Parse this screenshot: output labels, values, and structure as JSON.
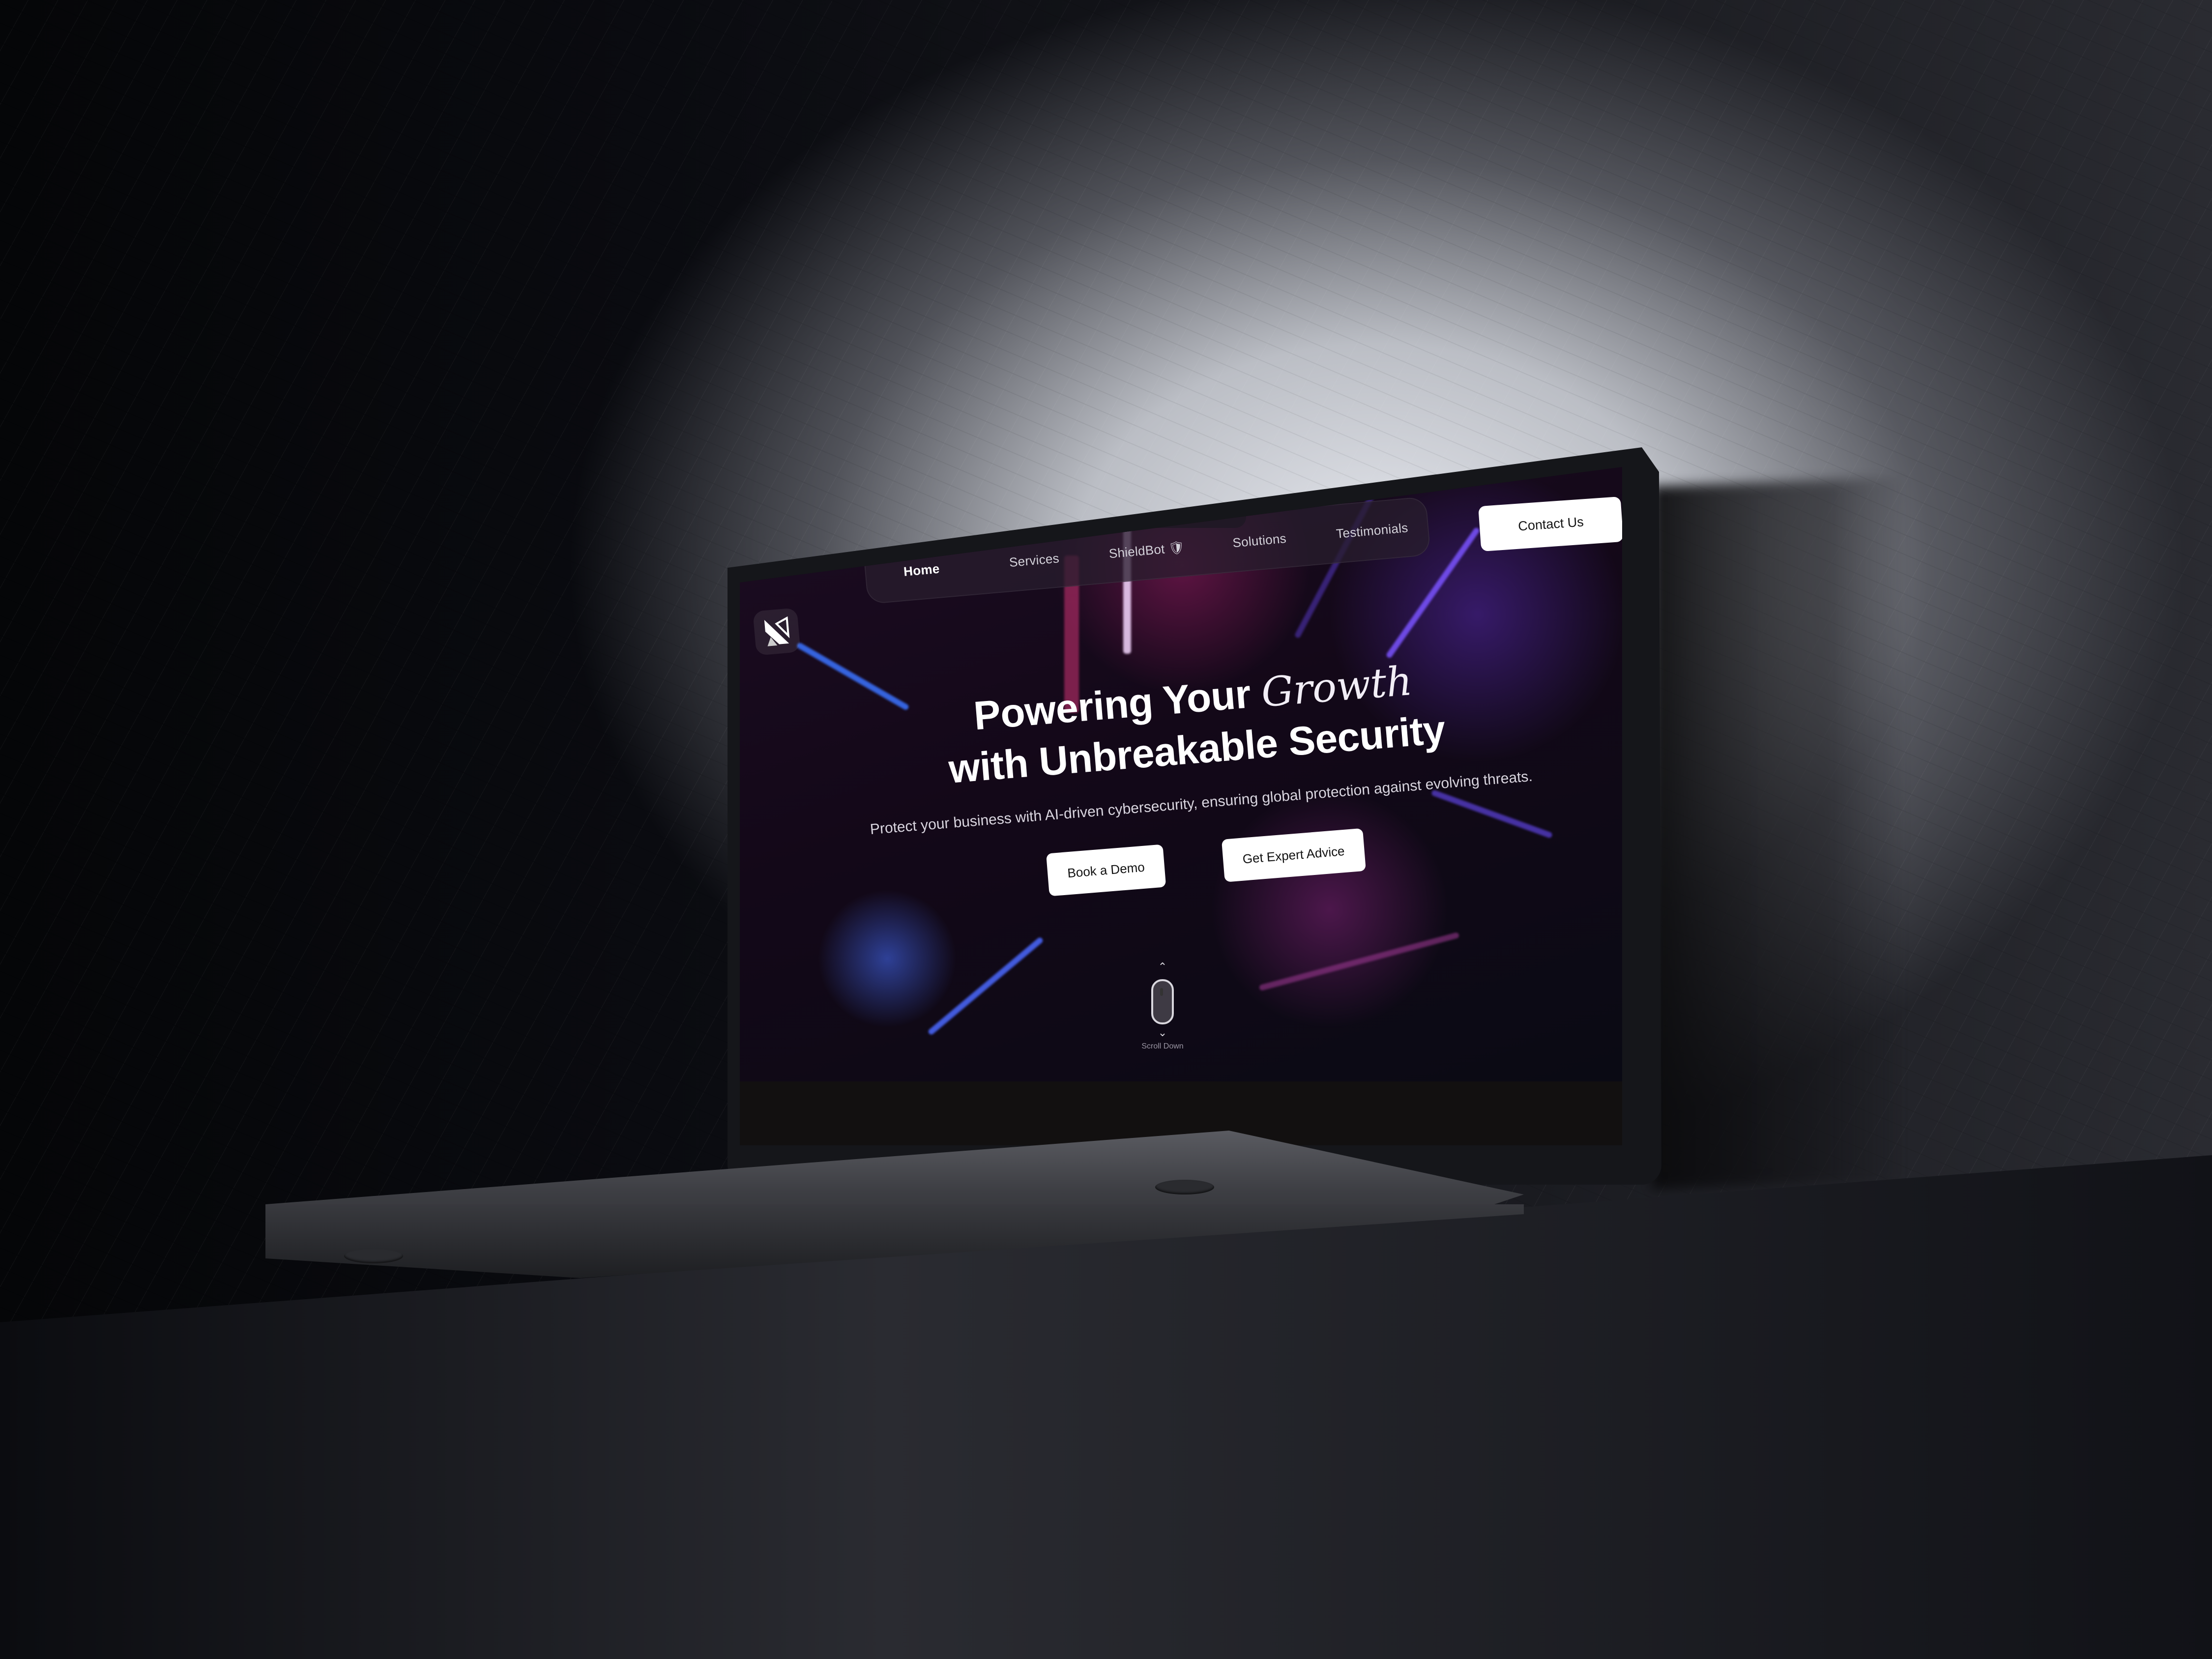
{
  "site": {
    "nav": [
      {
        "label": "Home",
        "active": true
      },
      {
        "label": "Services"
      },
      {
        "label": "ShieldBot 🛡"
      },
      {
        "label": "Solutions"
      },
      {
        "label": "Testimonials"
      }
    ],
    "contact_button": "Contact Us",
    "hero": {
      "title_line1_start": "Powering Your",
      "title_line1_script": "Growth",
      "title_line2": "with Unbreakable Security",
      "subtitle": "Protect your business with AI-driven cybersecurity, ensuring global protection against evolving threats.",
      "primary_button": "Book a Demo",
      "secondary_button": "Get Expert Advice"
    },
    "scroll_hint": "Scroll Down"
  },
  "colors": {
    "hero_bg": "#130818",
    "accent_blue": "#4a6cff",
    "accent_magenta": "#c0307e",
    "button_bg": "#ffffff"
  },
  "icons": {
    "logo": "brand-logo-icon",
    "mouse": "mouse-scroll-icon"
  }
}
